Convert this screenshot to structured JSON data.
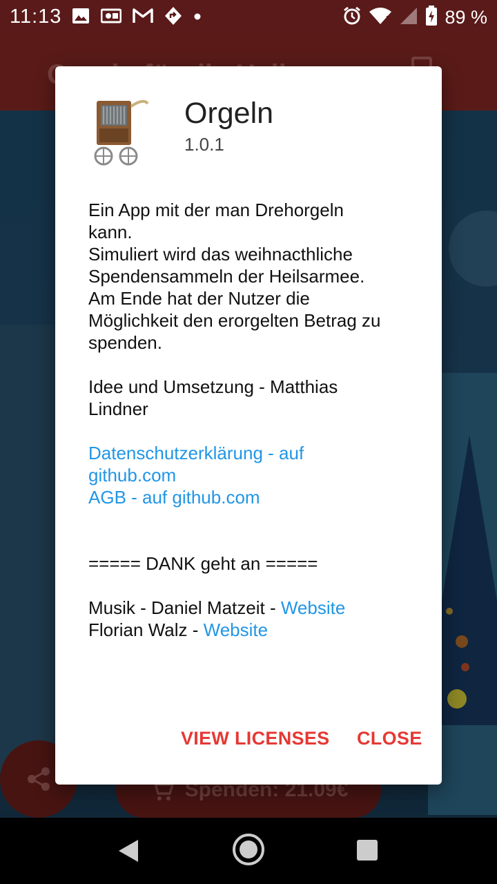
{
  "status_bar": {
    "time": "11:13",
    "battery_percent": "89 %",
    "left_icons": [
      "image-icon",
      "media-icon",
      "gmail-icon",
      "nav-icon",
      "dot-icon"
    ],
    "right_icons": [
      "alarm-icon",
      "wifi-icon",
      "signal-icon",
      "battery-icon"
    ]
  },
  "app_background": {
    "title": "Orgeln für die Heilsarmee",
    "donate_button": "Spenden: 21.09€"
  },
  "dialog": {
    "app_name": "Orgeln",
    "version": "1.0.1",
    "description_lines": [
      "Ein App mit der man Drehorgeln",
      "kann.",
      "Simuliert wird das weihnacthliche",
      "Spendensammeln der Heilsarmee.",
      "Am Ende hat der Nutzer die",
      "Möglichkeit den erorgelten Betrag zu",
      "spenden."
    ],
    "credits_lines": [
      "Idee und Umsetzung - Matthias",
      "Lindner"
    ],
    "privacy_link_lines": [
      "Datenschutzerklärung - auf",
      "github.com"
    ],
    "terms_link": "AGB  - auf github.com",
    "thanks_heading": "===== DANK geht an =====",
    "thanks": [
      {
        "text": "Musik - Daniel Matzeit - ",
        "link": "Website"
      },
      {
        "text": "Florian Walz - ",
        "link": "Website"
      }
    ],
    "buttons": {
      "view_licenses": "VIEW LICENSES",
      "close": "CLOSE"
    }
  },
  "colors": {
    "link": "#2196e6",
    "button": "#e53935",
    "status_bar": "#5a1a1a",
    "app_bar": "#8a2a26"
  }
}
